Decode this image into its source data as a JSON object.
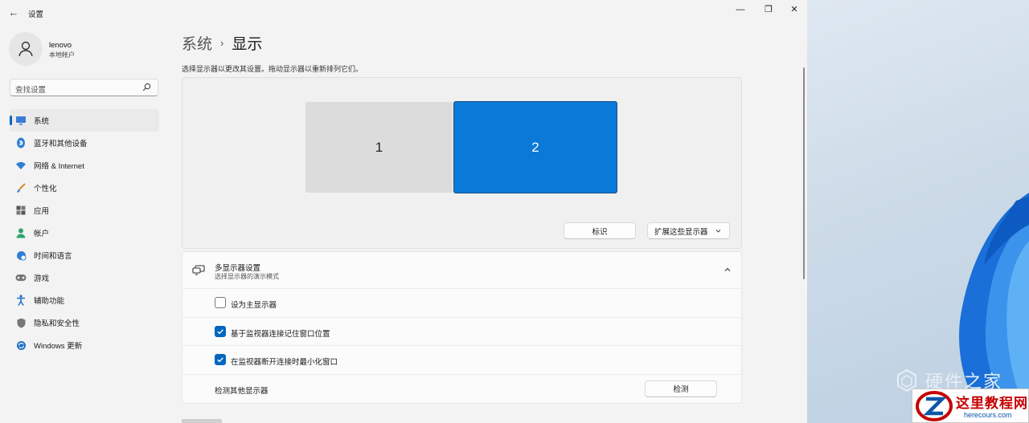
{
  "window": {
    "title": "设置"
  },
  "profile": {
    "name": "lenovo",
    "type": "本地帐户"
  },
  "search": {
    "placeholder": "查找设置"
  },
  "nav": [
    {
      "label": "系统",
      "icon": "display-icon",
      "active": true
    },
    {
      "label": "蓝牙和其他设备",
      "icon": "bluetooth-icon"
    },
    {
      "label": "网络 & Internet",
      "icon": "wifi-icon"
    },
    {
      "label": "个性化",
      "icon": "brush-icon"
    },
    {
      "label": "应用",
      "icon": "apps-icon"
    },
    {
      "label": "帐户",
      "icon": "person-icon"
    },
    {
      "label": "时间和语言",
      "icon": "globe-clock-icon"
    },
    {
      "label": "游戏",
      "icon": "gamepad-icon"
    },
    {
      "label": "辅助功能",
      "icon": "accessibility-icon"
    },
    {
      "label": "隐私和安全性",
      "icon": "shield-icon"
    },
    {
      "label": "Windows 更新",
      "icon": "update-icon"
    }
  ],
  "breadcrumb": {
    "parent": "系统",
    "current": "显示"
  },
  "description": "选择显示器以更改其设置。拖动显示器以重新排列它们。",
  "monitors": {
    "m1": "1",
    "m2": "2"
  },
  "buttons": {
    "identify": "标识",
    "extend": "扩展这些显示器",
    "detect": "检测"
  },
  "multi": {
    "title": "多显示器设置",
    "subtitle": "选择显示器的演示模式",
    "options": [
      {
        "label": "设为主显示器",
        "checked": false
      },
      {
        "label": "基于监视器连接记住窗口位置",
        "checked": true
      },
      {
        "label": "在监视器断开连接时最小化窗口",
        "checked": true
      }
    ],
    "detect_label": "检测其他显示器"
  },
  "watermark": {
    "text": "硬件之家",
    "logo_text": "这里教程网",
    "logo_url": "herecours.com"
  },
  "colors": {
    "accent": "#0067c0",
    "monitor_selected": "#0a79d8",
    "monitor_other": "#dcdcdc"
  }
}
